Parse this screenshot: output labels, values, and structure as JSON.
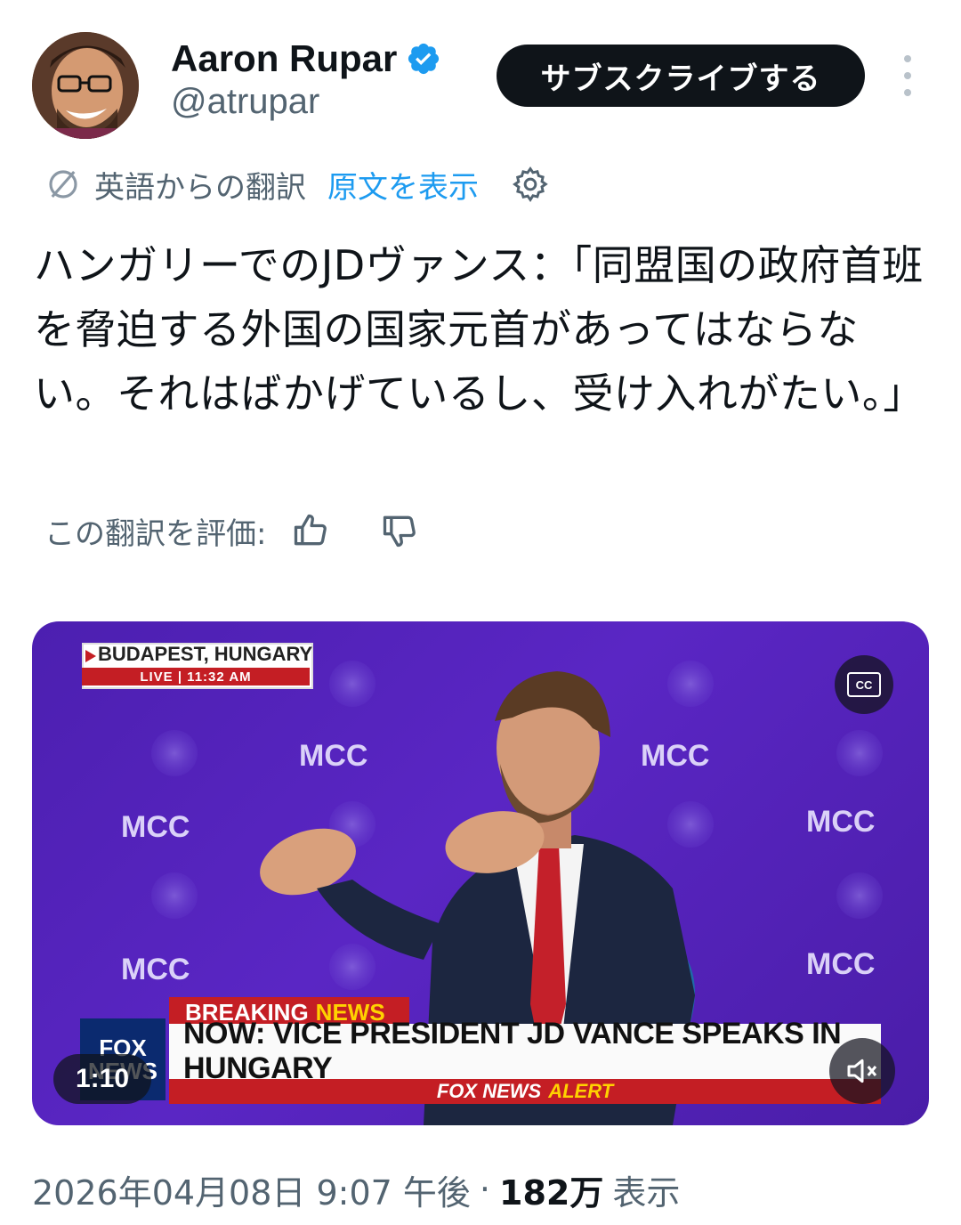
{
  "author": {
    "name": "Aaron Rupar",
    "handle": "@atrupar",
    "verified_color": "#1d9bf0"
  },
  "subscribe_label": "サブスクライブする",
  "translation": {
    "label": "英語からの翻訳",
    "show_original": "原文を表示"
  },
  "tweet": {
    "text": "ハンガリーでのJDヴァンス：「同盟国の政府首班を脅迫する外国の国家元首があってはならない。それはばかげているし、受け入れがたい。」"
  },
  "rate": {
    "label": "この翻訳を評価:"
  },
  "video": {
    "location": "BUDAPEST, HUNGARY",
    "live": "LIVE | 11:32 AM",
    "breaking_a": "BREAKING",
    "breaking_b": "NEWS",
    "headline": "NOW: VICE PRESIDENT JD VANCE SPEAKS IN HUNGARY",
    "alert_a": "FOX NEWS",
    "alert_b": "ALERT",
    "fox_top": "FOX",
    "fox_bottom": "NEWS",
    "duration": "1:10",
    "cc": "CC",
    "backdrop_logo": "MCC",
    "accent_color": "#c41e24"
  },
  "meta": {
    "datetime": "2026年04月08日 9:07 午後",
    "dot": "·",
    "views": "182万",
    "views_label": "表示"
  }
}
